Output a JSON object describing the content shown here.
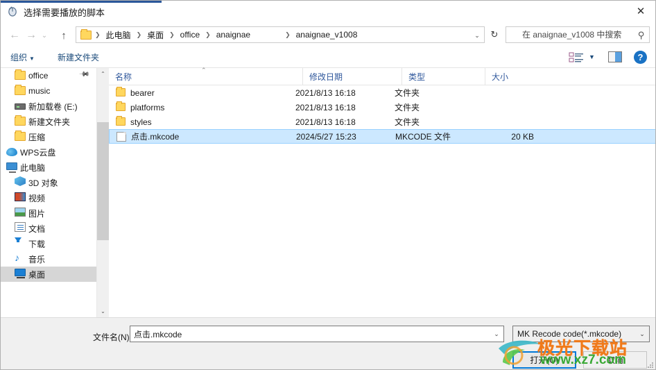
{
  "window": {
    "title": "选择需要播放的脚本",
    "app_icon": "mouse-cursor-icon",
    "close_label": "✕",
    "accent_color": "#2b579a"
  },
  "navbar": {
    "back_icon": "←",
    "forward_icon": "→",
    "recent_icon": "⌄",
    "up_icon": "↑",
    "refresh_icon": "↻",
    "breadcrumb": [
      "此电脑",
      "桌面",
      "office",
      "anaignae",
      "anaignae_v1008"
    ],
    "breadcrumb_dropdown_icon": "⌄",
    "search": {
      "placeholder": "在 anaignae_v1008 中搜索",
      "value": "",
      "icon": "search-icon"
    }
  },
  "toolbar": {
    "organize_label": "组织",
    "organize_caret": "▼",
    "new_folder_label": "新建文件夹",
    "view_caret": "▼",
    "help_label": "?"
  },
  "sidebar": {
    "items": [
      {
        "label": "office",
        "icon": "folder-icon",
        "indent": 1,
        "pinned": true,
        "selected": false
      },
      {
        "label": "music",
        "icon": "folder-icon",
        "indent": 1,
        "pinned": false,
        "selected": false
      },
      {
        "label": "新加载卷 (E:)",
        "icon": "drive-icon",
        "indent": 1,
        "pinned": false,
        "selected": false
      },
      {
        "label": "新建文件夹",
        "icon": "folder-icon",
        "indent": 1,
        "pinned": false,
        "selected": false
      },
      {
        "label": "压缩",
        "icon": "folder-icon",
        "indent": 1,
        "pinned": false,
        "selected": false
      },
      {
        "label": "WPS云盘",
        "icon": "cloud-icon",
        "indent": 0,
        "pinned": false,
        "selected": false
      },
      {
        "label": "此电脑",
        "icon": "computer-icon",
        "indent": 0,
        "pinned": false,
        "selected": false
      },
      {
        "label": "3D 对象",
        "icon": "3d-object-icon",
        "indent": 1,
        "pinned": false,
        "selected": false
      },
      {
        "label": "视频",
        "icon": "video-icon",
        "indent": 1,
        "pinned": false,
        "selected": false
      },
      {
        "label": "图片",
        "icon": "picture-icon",
        "indent": 1,
        "pinned": false,
        "selected": false
      },
      {
        "label": "文档",
        "icon": "document-icon",
        "indent": 1,
        "pinned": false,
        "selected": false
      },
      {
        "label": "下载",
        "icon": "download-icon",
        "indent": 1,
        "pinned": false,
        "selected": false
      },
      {
        "label": "音乐",
        "icon": "music-icon",
        "indent": 1,
        "pinned": false,
        "selected": false
      },
      {
        "label": "桌面",
        "icon": "desktop-icon",
        "indent": 1,
        "pinned": false,
        "selected": true
      }
    ],
    "scroll_up_icon": "⌃",
    "scroll_down_icon": "⌄"
  },
  "filelist": {
    "columns": [
      "名称",
      "修改日期",
      "类型",
      "大小"
    ],
    "sort_indicator": "⌃",
    "rows": [
      {
        "name": "bearer",
        "date": "2021/8/13 16:18",
        "type": "文件夹",
        "size": "",
        "icon": "folder-icon",
        "selected": false
      },
      {
        "name": "platforms",
        "date": "2021/8/13 16:18",
        "type": "文件夹",
        "size": "",
        "icon": "folder-icon",
        "selected": false
      },
      {
        "name": "styles",
        "date": "2021/8/13 16:18",
        "type": "文件夹",
        "size": "",
        "icon": "folder-icon",
        "selected": false
      },
      {
        "name": "点击.mkcode",
        "date": "2024/5/27 15:23",
        "type": "MKCODE 文件",
        "size": "20 KB",
        "icon": "file-icon",
        "selected": true
      }
    ]
  },
  "bottom": {
    "filename_label": "文件名(N):",
    "filename_value": "点击.mkcode",
    "filename_caret": "⌄",
    "filter_value": "MK Recode code(*.mkcode)",
    "filter_caret": "⌄",
    "open_label": "打开(O)",
    "cancel_label": "取消"
  },
  "watermark": {
    "site_name": "极光下载站",
    "url": "www.xz7.com",
    "name_color": "#f07a1a",
    "url_color": "#39a935"
  }
}
